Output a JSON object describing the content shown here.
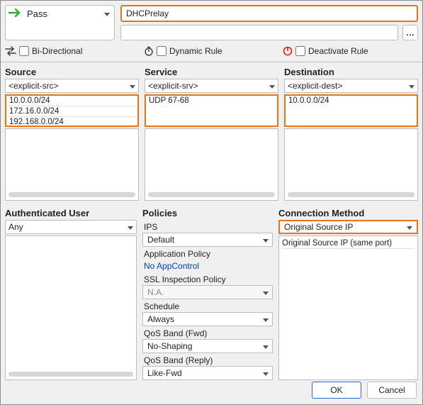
{
  "top": {
    "action": "Pass",
    "rule_name": "DHCPrelay"
  },
  "flags": {
    "bi_directional_label": "Bi-Directional",
    "dynamic_rule_label": "Dynamic Rule",
    "deactivate_rule_label": "Deactivate Rule"
  },
  "columns": {
    "source": {
      "title": "Source",
      "placeholder": "<explicit-src>",
      "items": [
        "10.0.0.0/24",
        "172.16.0.0/24",
        "192.168.0.0/24"
      ]
    },
    "service": {
      "title": "Service",
      "placeholder": "<explicit-srv>",
      "items": [
        "UDP  67-68"
      ]
    },
    "destination": {
      "title": "Destination",
      "placeholder": "<explicit-dest>",
      "items": [
        "10.0.0.0/24"
      ]
    }
  },
  "auth": {
    "title": "Authenticated User",
    "value": "Any"
  },
  "policies": {
    "title": "Policies",
    "ips_label": "IPS",
    "ips_value": "Default",
    "app_label": "Application Policy",
    "app_value": "No AppControl",
    "ssl_label": "SSL Inspection Policy",
    "ssl_value": "N.A.",
    "schedule_label": "Schedule",
    "schedule_value": "Always",
    "qos_fwd_label": "QoS Band (Fwd)",
    "qos_fwd_value": "No-Shaping",
    "qos_reply_label": "QoS Band (Reply)",
    "qos_reply_value": "Like-Fwd"
  },
  "connection": {
    "title": "Connection Method",
    "value": "Original Source IP",
    "list": [
      "Original Source IP (same port)"
    ]
  },
  "buttons": {
    "ok": "OK",
    "cancel": "Cancel"
  }
}
